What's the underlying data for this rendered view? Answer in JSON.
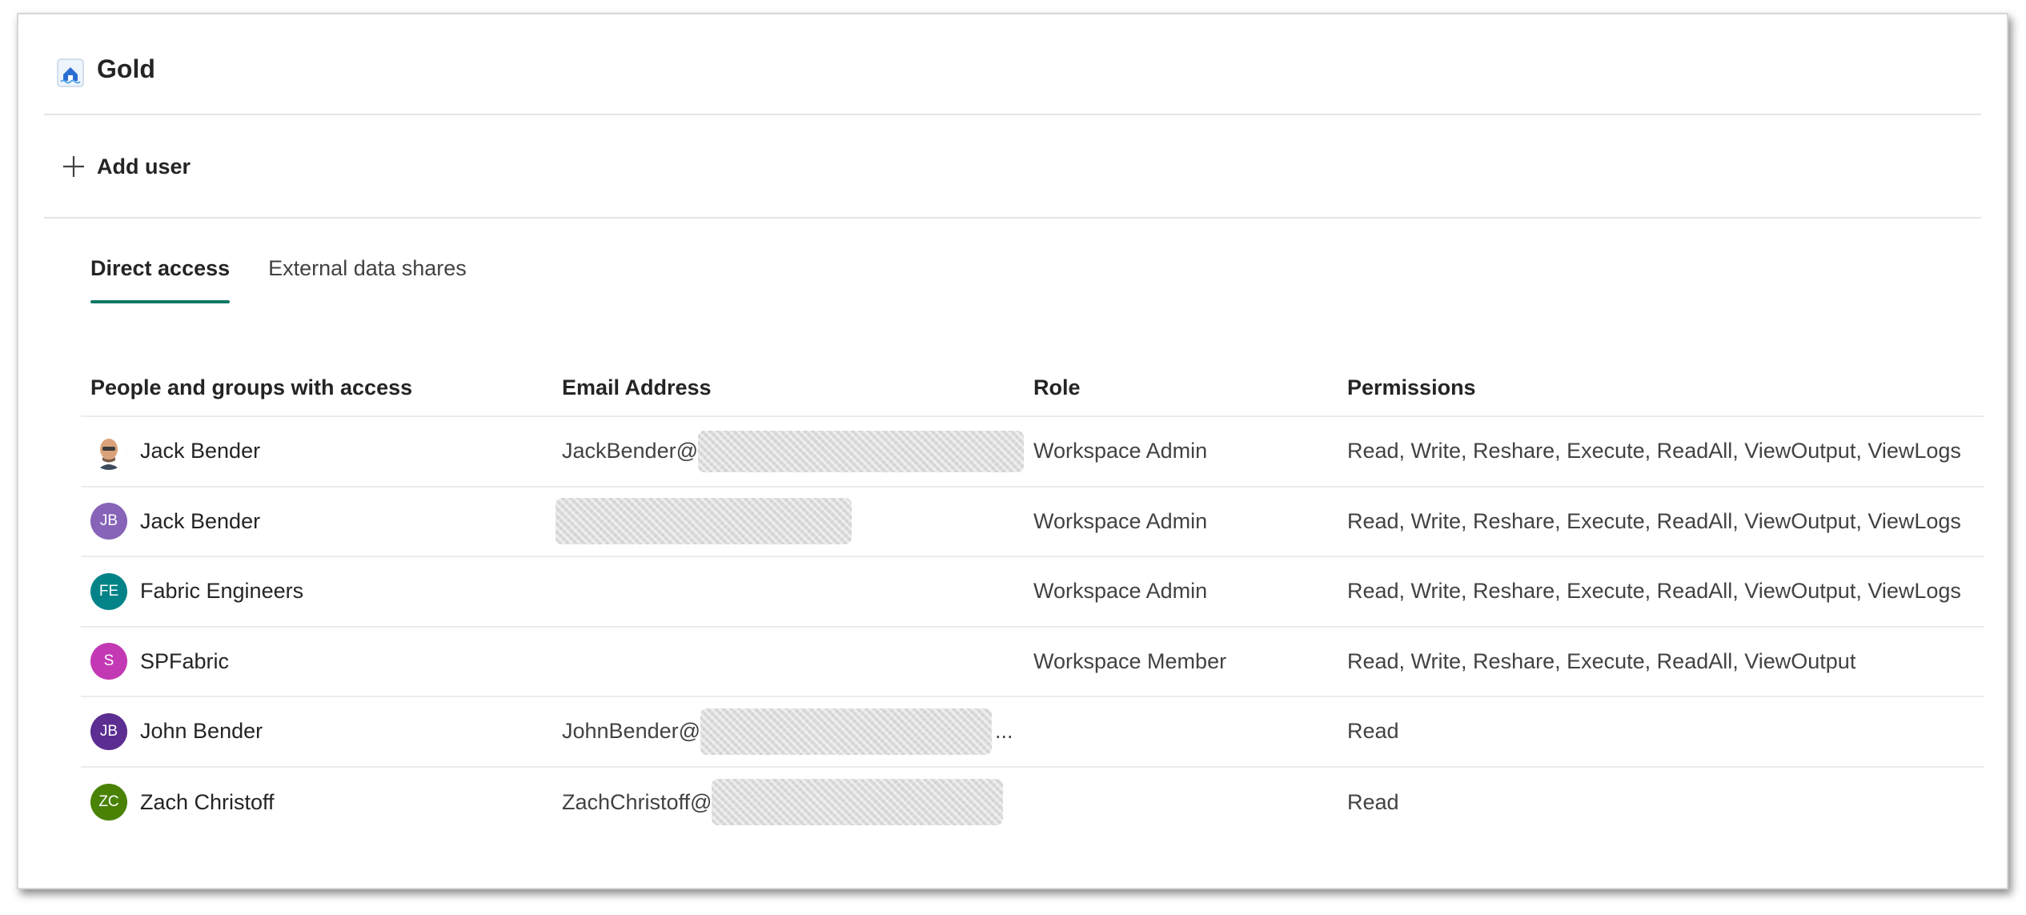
{
  "header": {
    "title": "Gold",
    "icon": "lakehouse-icon"
  },
  "toolbar": {
    "add_user_label": "Add user",
    "add_icon": "plus-icon"
  },
  "tabs": [
    {
      "label": "Direct access",
      "active": true
    },
    {
      "label": "External data shares",
      "active": false
    }
  ],
  "table": {
    "columns": [
      "People and groups with access",
      "Email Address",
      "Role",
      "Permissions"
    ],
    "rows": [
      {
        "name": "Jack Bender",
        "avatar": "photo",
        "initials": "",
        "avatar_color": "#f3e5d0",
        "email": "JackBender@",
        "email_redacted": true,
        "role": "Workspace Admin",
        "permissions": "Read, Write, Reshare, Execute, ReadAll, ViewOutput, ViewLogs"
      },
      {
        "name": "Jack Bender",
        "avatar": "initials",
        "initials": "JB",
        "avatar_color": "#8764b8",
        "email": "",
        "email_redacted": true,
        "role": "Workspace Admin",
        "permissions": "Read, Write, Reshare, Execute, ReadAll, ViewOutput, ViewLogs"
      },
      {
        "name": "Fabric Engineers",
        "avatar": "initials",
        "initials": "FE",
        "avatar_color": "#038387",
        "email": "",
        "email_redacted": false,
        "role": "Workspace Admin",
        "permissions": "Read, Write, Reshare, Execute, ReadAll, ViewOutput, ViewLogs"
      },
      {
        "name": "SPFabric",
        "avatar": "initials",
        "initials": "S",
        "avatar_color": "#c239b3",
        "email": "",
        "email_redacted": false,
        "role": "Workspace Member",
        "permissions": "Read, Write, Reshare, Execute, ReadAll, ViewOutput"
      },
      {
        "name": "John Bender",
        "avatar": "initials",
        "initials": "JB",
        "avatar_color": "#5c2e91",
        "email": "JohnBender@",
        "email_redacted": true,
        "email_truncated": "...",
        "role": "",
        "permissions": "Read"
      },
      {
        "name": "Zach Christoff",
        "avatar": "initials",
        "initials": "ZC",
        "avatar_color": "#498205",
        "email": "ZachChristoff@",
        "email_redacted": true,
        "role": "",
        "permissions": "Read"
      }
    ]
  }
}
